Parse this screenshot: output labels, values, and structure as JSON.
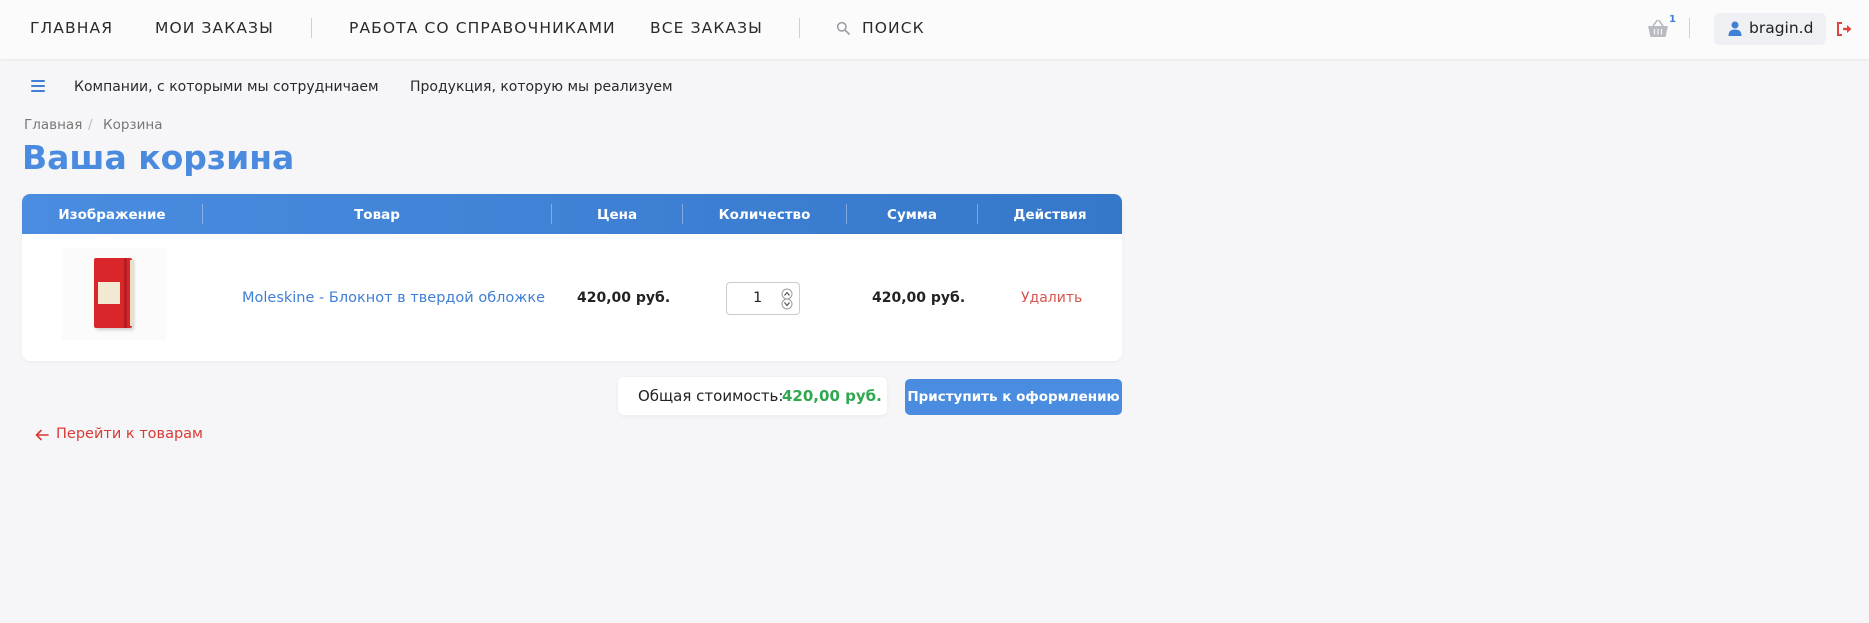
{
  "nav": {
    "home": "ГЛАВНАЯ",
    "my_orders": "МОИ ЗАКАЗЫ",
    "directories": "РАБОТА СО СПРАВОЧНИКАМИ",
    "all_orders": "ВСЕ ЗАКАЗЫ",
    "search": "ПОИСК",
    "cart_count": "1",
    "username": "bragin.d"
  },
  "subnav": {
    "companies": "Компании, с которыми мы сотрудничаем",
    "products": "Продукция, которую мы реализуем"
  },
  "breadcrumb": {
    "items": [
      "Главная",
      "Корзина"
    ],
    "separator": "/"
  },
  "page": {
    "title": "Ваша корзина"
  },
  "table": {
    "headers": [
      "Изображение",
      "Товар",
      "Цена",
      "Количество",
      "Сумма",
      "Действия"
    ],
    "rows": [
      {
        "product": "Moleskine - Блокнот в твердой обложке",
        "price": "420,00 руб.",
        "quantity": "1",
        "sum": "420,00 руб.",
        "action": "Удалить"
      }
    ]
  },
  "summary": {
    "total_label": "Общая стоимость:",
    "total_value": "420,00 руб.",
    "checkout_label": "Приступить к оформлению"
  },
  "back": {
    "label": "Перейти к товарам"
  },
  "colors": {
    "accent": "#4a8de0",
    "danger": "#d93a34",
    "success": "#2fa84f"
  }
}
